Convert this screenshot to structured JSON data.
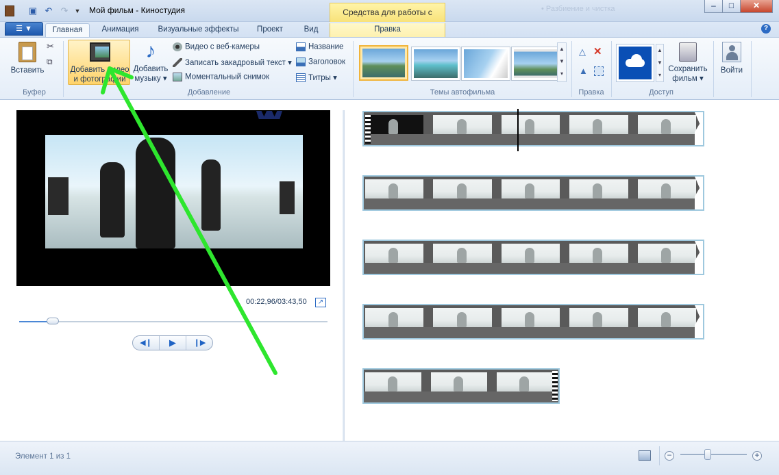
{
  "window": {
    "title": "Мой фильм - Киностудия",
    "context_header": "Средства для работы с видео",
    "ghost_text": "• Разбиение и чистка"
  },
  "tabs": [
    {
      "label": "Главная"
    },
    {
      "label": "Анимация"
    },
    {
      "label": "Визуальные эффекты"
    },
    {
      "label": "Проект"
    },
    {
      "label": "Вид"
    },
    {
      "label": "Правка"
    }
  ],
  "ribbon": {
    "clipboard": {
      "paste": "Вставить",
      "group": "Буфер"
    },
    "add": {
      "add_video_line1": "Добавить видео",
      "add_video_line2": "и фотографии",
      "add_music_line1": "Добавить",
      "add_music_line2": "музыку",
      "webcam": "Видео с веб-камеры",
      "narration": "Записать закадровый текст",
      "snapshot": "Моментальный снимок",
      "title": "Название",
      "caption": "Заголовок",
      "credits": "Титры",
      "group": "Добавление"
    },
    "themes": {
      "group": "Темы автофильма"
    },
    "editing": {
      "group": "Правка"
    },
    "share": {
      "save_line1": "Сохранить",
      "save_line2": "фильм",
      "group": "Доступ"
    },
    "signin": {
      "label": "Войти"
    }
  },
  "player": {
    "timecode": "00:22,96/03:43,50",
    "progress_fraction": 0.103
  },
  "status": {
    "text": "Элемент 1 из 1"
  },
  "colors": {
    "accent": "#1d58ad",
    "selected_button": "#ffd36b",
    "annotation_arrow": "#2ee62e",
    "storyboard_border": "#9ec8de"
  },
  "icons": [
    "save-icon",
    "undo-icon",
    "redo-icon",
    "paste-icon",
    "cut-icon",
    "copy-icon",
    "film-photo-icon",
    "music-note-icon",
    "webcam-icon",
    "microphone-icon",
    "snapshot-icon",
    "title-icon",
    "caption-icon",
    "credits-icon",
    "rotate-left-icon",
    "remove-icon",
    "rotate-right-icon",
    "select-all-icon",
    "onedrive-cloud-icon",
    "save-movie-icon",
    "user-icon",
    "help-icon",
    "fullscreen-icon",
    "zoom-out-icon",
    "zoom-in-icon"
  ]
}
